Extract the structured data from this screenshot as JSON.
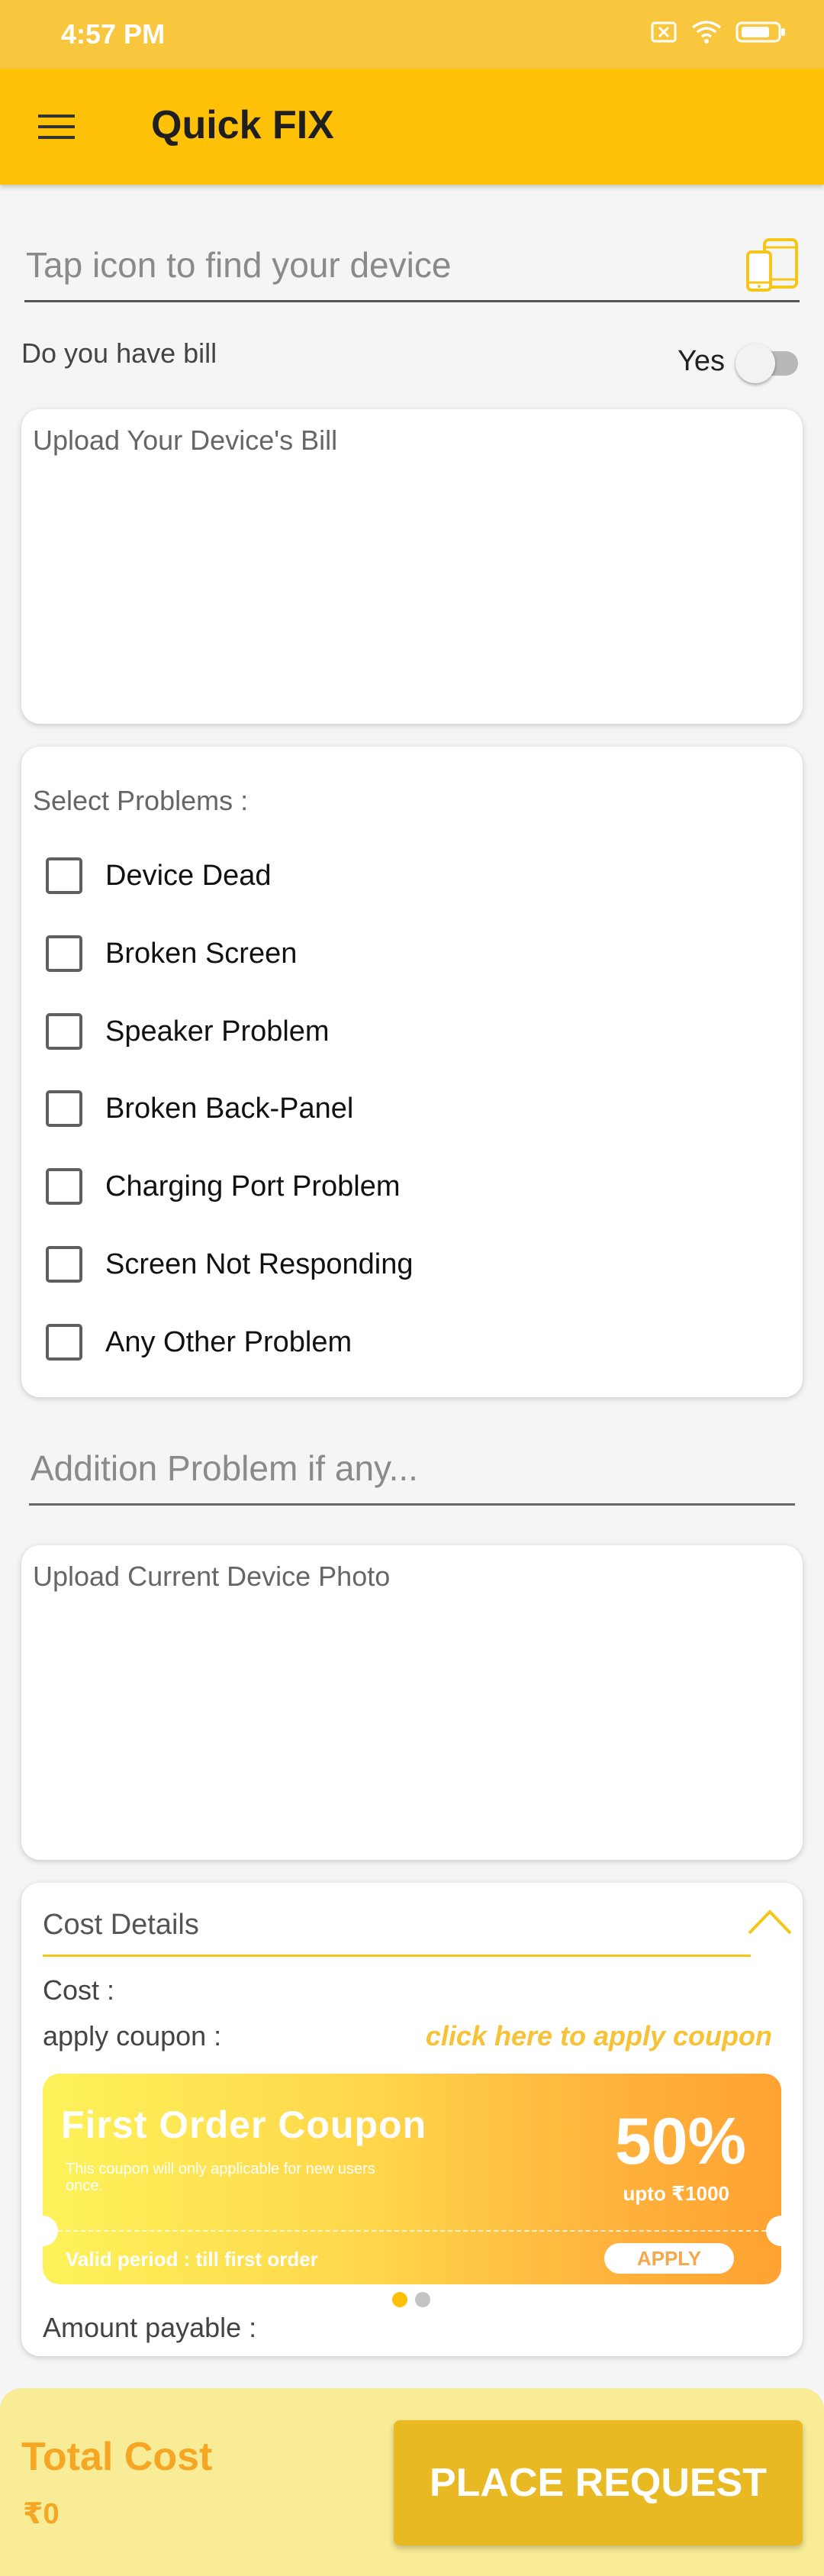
{
  "status_bar": {
    "time": "4:57 PM",
    "icons": [
      "sim-off-icon",
      "wifi-icon",
      "battery-icon"
    ]
  },
  "app_bar": {
    "title": "Quick FIX",
    "menu_icon": "hamburger-menu-icon"
  },
  "device_search": {
    "placeholder": "Tap icon to find your device",
    "icon": "devices-icon"
  },
  "bill": {
    "question": "Do you have bill",
    "toggle_label": "Yes",
    "toggle_on": false
  },
  "bill_upload": {
    "caption": "Upload Your Device's Bill"
  },
  "problems": {
    "caption": "Select Problems :",
    "items": [
      {
        "label": "Device Dead",
        "checked": false
      },
      {
        "label": "Broken Screen",
        "checked": false
      },
      {
        "label": "Speaker Problem",
        "checked": false
      },
      {
        "label": "Broken Back-Panel",
        "checked": false
      },
      {
        "label": "Charging Port Problem",
        "checked": false
      },
      {
        "label": "Screen Not Responding",
        "checked": false
      },
      {
        "label": "Any Other Problem",
        "checked": false
      }
    ]
  },
  "addition": {
    "placeholder": "Addition Problem if any..."
  },
  "photo_upload": {
    "caption": "Upload Current Device Photo"
  },
  "cost_details": {
    "title": "Cost Details",
    "cost_label": "Cost :",
    "coupon_label": "apply coupon :",
    "apply_link": "click here to apply coupon",
    "payable_label": "Amount payable :",
    "coupon": {
      "title": "First Order Coupon",
      "desc": "This coupon will only applicable for new users once.",
      "percent": "50%",
      "upto": "upto ₹1000",
      "validity": "Valid period : till first order",
      "apply_button": "APPLY"
    },
    "carousel": {
      "count": 2,
      "active": 0
    }
  },
  "footer": {
    "total_label": "Total Cost",
    "total_value": "₹0",
    "place_button": "PLACE REQUEST"
  },
  "colors": {
    "accent": "#ffc107",
    "status_bar": "#f8c73e",
    "footer_bg": "#f8ec96",
    "total_text": "#f5a623",
    "place_button": "#e8b923"
  }
}
